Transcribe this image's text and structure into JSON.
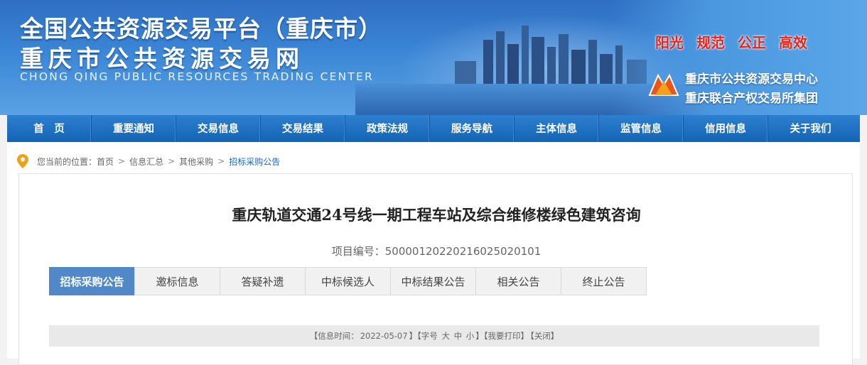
{
  "header": {
    "title_line1": "全国公共资源交易平台（重庆市）",
    "title_line2": "重庆市公共资源交易网",
    "title_en": "CHONG QING PUBLIC RESOURCES TRADING CENTER",
    "slogans": [
      "阳光",
      "规范",
      "公正",
      "高效"
    ],
    "org_line1": "重庆市公共资源交易中心",
    "org_line2": "重庆联合产权交易所集团",
    "logo_icon": "center-logo-icon"
  },
  "nav": {
    "items": [
      "首　页",
      "重要通知",
      "交易信息",
      "交易结果",
      "政策法规",
      "服务导航",
      "主体信息",
      "监管信息",
      "信用信息",
      "关于我们"
    ]
  },
  "breadcrumb": {
    "prefix": "您当前的位置：",
    "items": [
      "首页",
      "信息汇总",
      "其他采购",
      "招标采购公告"
    ],
    "separator": ">",
    "icon": "location-pin-icon"
  },
  "document": {
    "title": "重庆轨道交通24号线一期工程车站及综合维修楼绿色建筑咨询",
    "project_no_label": "项目编号：",
    "project_no": "500001202202160250201​01"
  },
  "tabs": {
    "active_index": 0,
    "items": [
      "招标采购公告",
      "邀标信息",
      "答疑补遗",
      "中标候选人",
      "中标结果公告",
      "相关公告",
      "终止公告"
    ]
  },
  "info_bar": {
    "time_label": "【信息时间：",
    "time_value": "2022-05-07",
    "font_label": "】【字号",
    "font_large": "大",
    "font_medium": "中",
    "font_small": "小",
    "print": "】【我要打印】",
    "close": "【关闭】"
  },
  "colors": {
    "nav_bg": "#1a6cbd",
    "active_tab": "#5088c8",
    "slogan": "#e8231a",
    "link_active": "#1a66c8"
  }
}
